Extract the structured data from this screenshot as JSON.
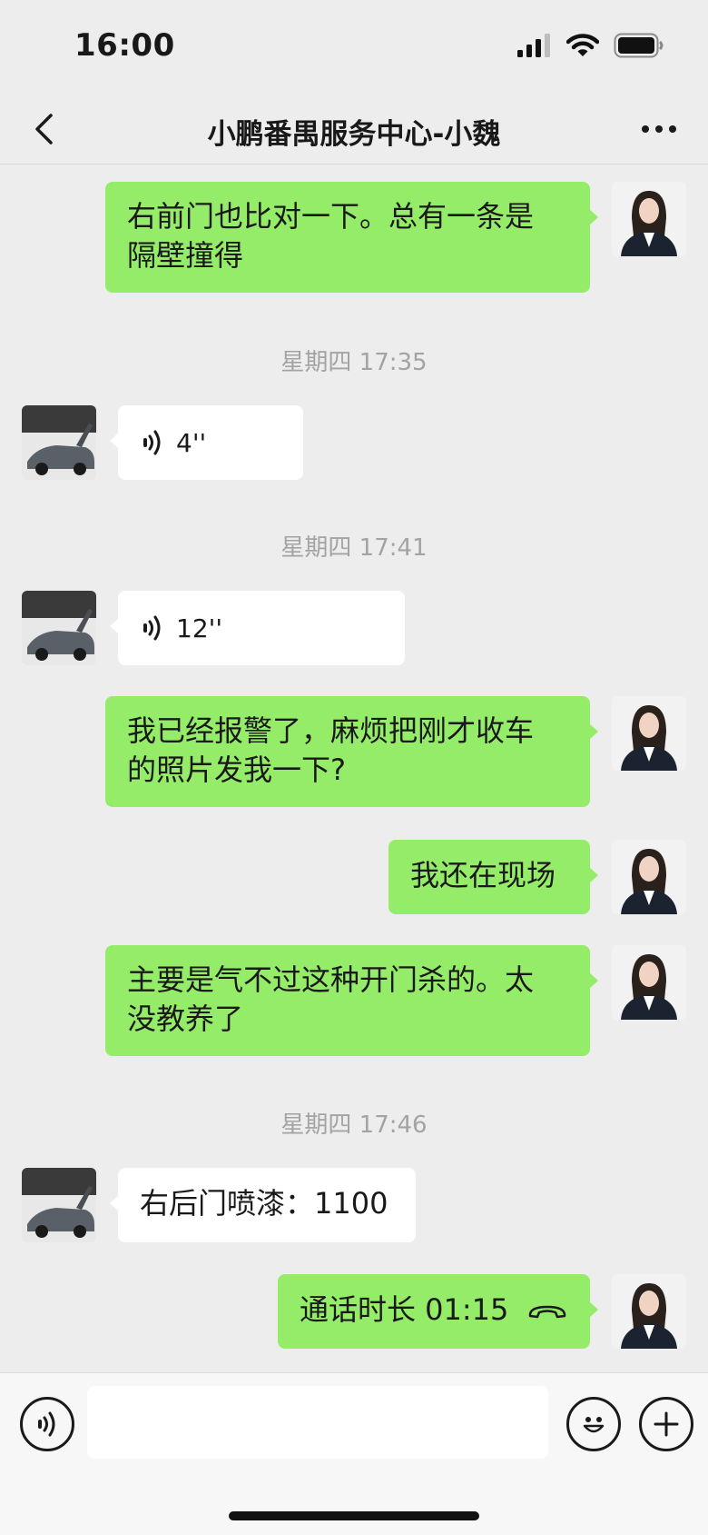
{
  "status_bar": {
    "time": "16:00"
  },
  "header": {
    "title": "小鹏番禺服务中心-小魏"
  },
  "messages": [
    {
      "type": "text",
      "from": "me",
      "lines": [
        "右前门也比对一下。总有一条是",
        "隔壁撞得"
      ]
    },
    {
      "type": "time",
      "text": "星期四 17:35"
    },
    {
      "type": "voice",
      "from": "other",
      "duration": "4''"
    },
    {
      "type": "time",
      "text": "星期四 17:41"
    },
    {
      "type": "voice",
      "from": "other",
      "duration": "12''"
    },
    {
      "type": "text",
      "from": "me",
      "lines": [
        "我已经报警了，麻烦把刚才收车",
        "的照片发我一下?"
      ]
    },
    {
      "type": "text",
      "from": "me",
      "lines": [
        "我还在现场"
      ]
    },
    {
      "type": "text",
      "from": "me",
      "lines": [
        "主要是气不过这种开门杀的。太",
        "没教养了"
      ]
    },
    {
      "type": "time",
      "text": "星期四 17:46"
    },
    {
      "type": "text",
      "from": "other",
      "lines": [
        "右后门喷漆：1100"
      ]
    },
    {
      "type": "call",
      "from": "me",
      "label": "通话时长 01:15"
    }
  ],
  "input_bar": {
    "voice_icon": "voice-icon",
    "emoji_icon": "emoji-icon",
    "plus_icon": "plus-icon"
  },
  "colors": {
    "my_bubble": "#95ec69",
    "other_bubble": "#ffffff",
    "background": "#ededed",
    "timestamp": "#a3a3a3"
  }
}
